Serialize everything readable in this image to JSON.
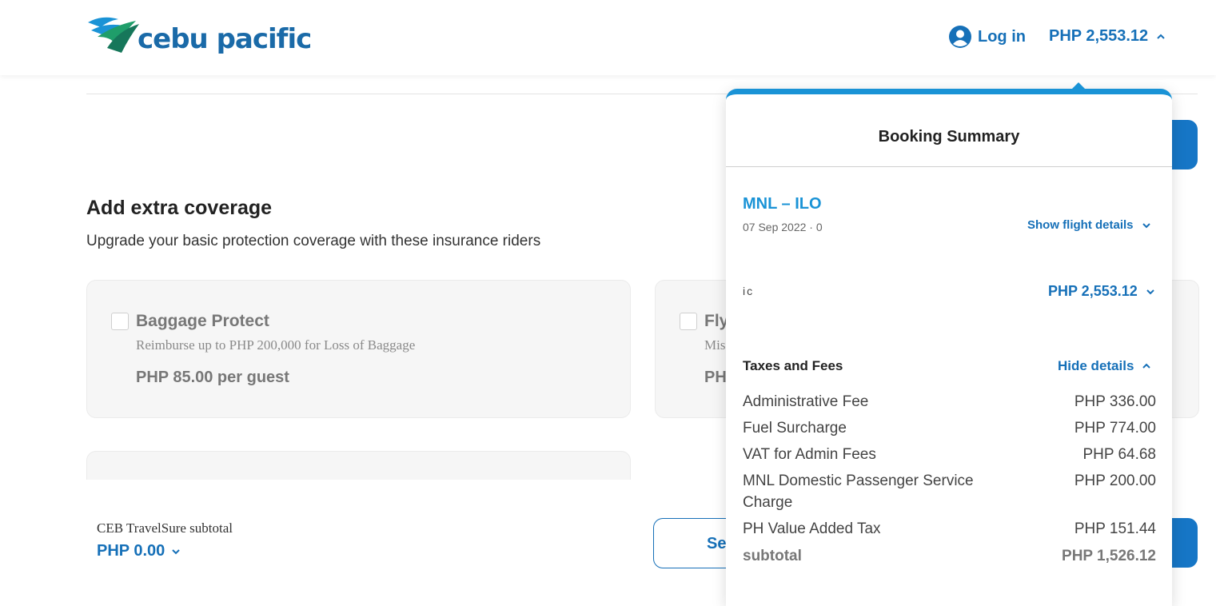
{
  "header": {
    "brand": "cebu pacific",
    "login_label": "Log in",
    "total_label": "PHP 2,553.12"
  },
  "coverage": {
    "title": "Add extra coverage",
    "subtitle": "Upgrade your basic protection coverage with these insurance riders",
    "cards": [
      {
        "title": "Baggage Protect",
        "desc": "Reimburse up to PHP 200,000 for Loss of Baggage",
        "price": "PHP 85.00 per guest"
      },
      {
        "title": "Fly",
        "desc": "Mis",
        "price": "PH"
      }
    ]
  },
  "footer": {
    "subtotal_label": "CEB TravelSure subtotal",
    "subtotal_value": "PHP 0.00",
    "outline_button_label": "Se"
  },
  "summary": {
    "title": "Booking Summary",
    "route": "MNL – ILO",
    "route_date": "07 Sep 2022 · 0",
    "show_details_label": "Show flight details",
    "fare_label": "ic",
    "fare_total": "PHP 2,553.12",
    "taxes_title": "Taxes and Fees",
    "hide_details_label": "Hide details",
    "fees": [
      {
        "name": "Administrative Fee",
        "amount": "PHP 336.00"
      },
      {
        "name": "Fuel Surcharge",
        "amount": "PHP 774.00"
      },
      {
        "name": "VAT for Admin Fees",
        "amount": "PHP 64.68"
      },
      {
        "name": "MNL Domestic Passenger Service Charge",
        "amount": "PHP 200.00"
      },
      {
        "name": "PH Value Added Tax",
        "amount": "PHP 151.44"
      }
    ],
    "subtotal_name": "subtotal",
    "subtotal_amount": "PHP 1,526.12"
  },
  "colors": {
    "brand_blue": "#1670b8",
    "accent_blue": "#1a93d6"
  },
  "icons": [
    "logo-bird-icon",
    "user-circle-icon",
    "chevron-up-icon",
    "chevron-down-icon"
  ]
}
